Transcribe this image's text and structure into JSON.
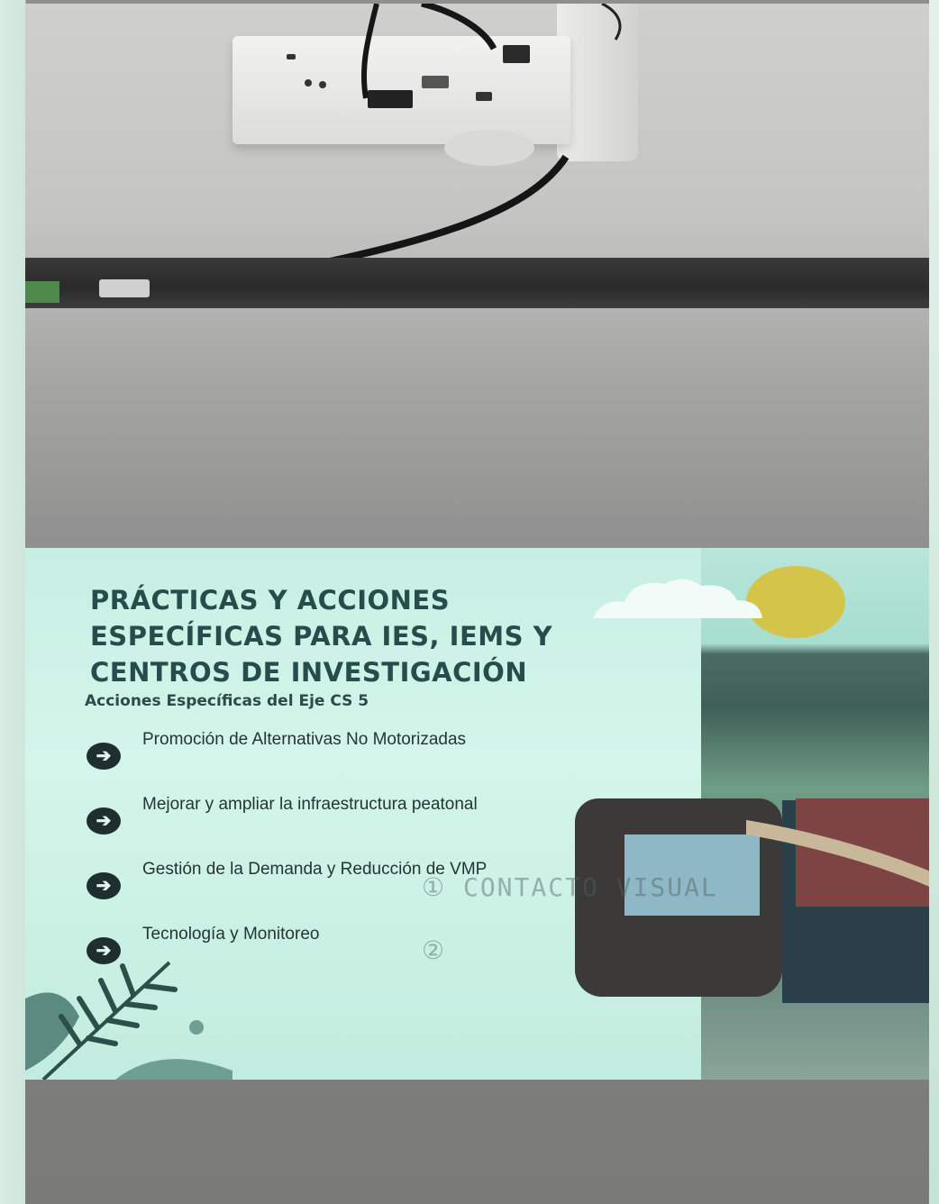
{
  "slide": {
    "title": "PRÁCTICAS Y ACCIONES ESPECÍFICAS PARA IES, IEMS Y CENTROS DE INVESTIGACIÓN",
    "subtitle": "Acciones Específicas del Eje CS 5",
    "items": [
      {
        "label": "Promoción de Alternativas No Motorizadas"
      },
      {
        "label": "Mejorar y ampliar la infraestructura peatonal"
      },
      {
        "label": "Gestión de la Demanda y Reducción de VMP"
      },
      {
        "label": "Tecnología y Monitoreo"
      }
    ],
    "bullet_icon": "arrow-right-circle-icon",
    "handwriting": {
      "note_1": "① CONTACTO VISUAL",
      "note_2": "②"
    }
  },
  "colors": {
    "title": "#244d4c",
    "slide_background": "#c8efe4",
    "sun": "#d4c44a",
    "screen_case": "#2a2a2a"
  }
}
